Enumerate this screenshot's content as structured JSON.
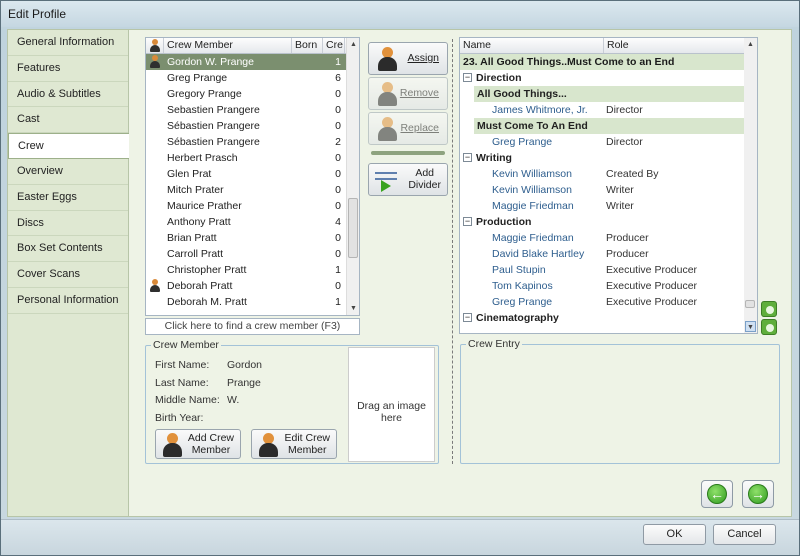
{
  "window": {
    "title": "Edit Profile"
  },
  "nav": [
    {
      "label": "General Information"
    },
    {
      "label": "Features"
    },
    {
      "label": "Audio & Subtitles"
    },
    {
      "label": "Cast"
    },
    {
      "label": "Crew",
      "active": true
    },
    {
      "label": "Overview"
    },
    {
      "label": "Easter Eggs"
    },
    {
      "label": "Discs"
    },
    {
      "label": "Box Set Contents"
    },
    {
      "label": "Cover Scans"
    },
    {
      "label": "Personal Information"
    }
  ],
  "crew_list": {
    "columns": [
      "Crew Member",
      "Born",
      "Cre"
    ],
    "rows": [
      {
        "name": "Gordon W. Prange",
        "born": "",
        "credits": "1",
        "selected": true,
        "icon": true
      },
      {
        "name": "Greg Prange",
        "born": "",
        "credits": "6"
      },
      {
        "name": "Gregory Prange",
        "born": "",
        "credits": "0"
      },
      {
        "name": "Sebastien Prangere",
        "born": "",
        "credits": "0"
      },
      {
        "name": "Sébastien Prangere",
        "born": "",
        "credits": "0"
      },
      {
        "name": "Sébastien Prangere",
        "born": "",
        "credits": "2"
      },
      {
        "name": "Herbert Prasch",
        "born": "",
        "credits": "0"
      },
      {
        "name": "Glen Prat",
        "born": "",
        "credits": "0"
      },
      {
        "name": "Mitch Prater",
        "born": "",
        "credits": "0"
      },
      {
        "name": "Maurice Prather",
        "born": "",
        "credits": "0"
      },
      {
        "name": "Anthony Pratt",
        "born": "",
        "credits": "4"
      },
      {
        "name": "Brian Pratt",
        "born": "",
        "credits": "0"
      },
      {
        "name": "Carroll Pratt",
        "born": "",
        "credits": "0"
      },
      {
        "name": "Christopher Pratt",
        "born": "",
        "credits": "1"
      },
      {
        "name": "Deborah Pratt",
        "born": "",
        "credits": "0",
        "icon": true
      },
      {
        "name": "Deborah M. Pratt",
        "born": "",
        "credits": "1"
      }
    ],
    "find_label": "Click here to find a crew member (F3)"
  },
  "actions": {
    "assign": "Assign",
    "remove": "Remove",
    "replace": "Replace",
    "add_divider_line1": "Add",
    "add_divider_line2": "Divider"
  },
  "tree": {
    "columns": [
      "Name",
      "Role"
    ],
    "title": "23. All Good Things..Must Come to an End",
    "rows": [
      {
        "type": "cat",
        "text": "Direction"
      },
      {
        "type": "sub",
        "text": "All Good Things..."
      },
      {
        "type": "ent",
        "name": "James Whitmore, Jr.",
        "role": "Director"
      },
      {
        "type": "sub",
        "text": "Must Come To An End"
      },
      {
        "type": "ent",
        "name": "Greg Prange",
        "role": "Director"
      },
      {
        "type": "cat",
        "text": "Writing"
      },
      {
        "type": "ent",
        "name": "Kevin Williamson",
        "role": "Created By"
      },
      {
        "type": "ent",
        "name": "Kevin Williamson",
        "role": "Writer"
      },
      {
        "type": "ent",
        "name": "Maggie Friedman",
        "role": "Writer"
      },
      {
        "type": "cat",
        "text": "Production"
      },
      {
        "type": "ent",
        "name": "Maggie Friedman",
        "role": "Producer"
      },
      {
        "type": "ent",
        "name": "David Blake Hartley",
        "role": "Producer"
      },
      {
        "type": "ent",
        "name": "Paul Stupin",
        "role": "Executive Producer"
      },
      {
        "type": "ent",
        "name": "Tom Kapinos",
        "role": "Executive Producer"
      },
      {
        "type": "ent",
        "name": "Greg Prange",
        "role": "Executive Producer"
      },
      {
        "type": "cat",
        "text": "Cinematography"
      }
    ]
  },
  "crew_member": {
    "legend": "Crew Member",
    "first_name_label": "First Name:",
    "first_name": "Gordon",
    "last_name_label": "Last Name:",
    "last_name": "Prange",
    "middle_name_label": "Middle Name:",
    "middle_name": "W.",
    "birth_year_label": "Birth Year:",
    "birth_year": "",
    "drop_label": "Drag an image here",
    "add_line1": "Add Crew",
    "add_line2": "Member",
    "edit_line1": "Edit Crew",
    "edit_line2": "Member"
  },
  "crew_entry": {
    "legend": "Crew Entry"
  },
  "footer": {
    "ok": "OK",
    "cancel": "Cancel"
  }
}
